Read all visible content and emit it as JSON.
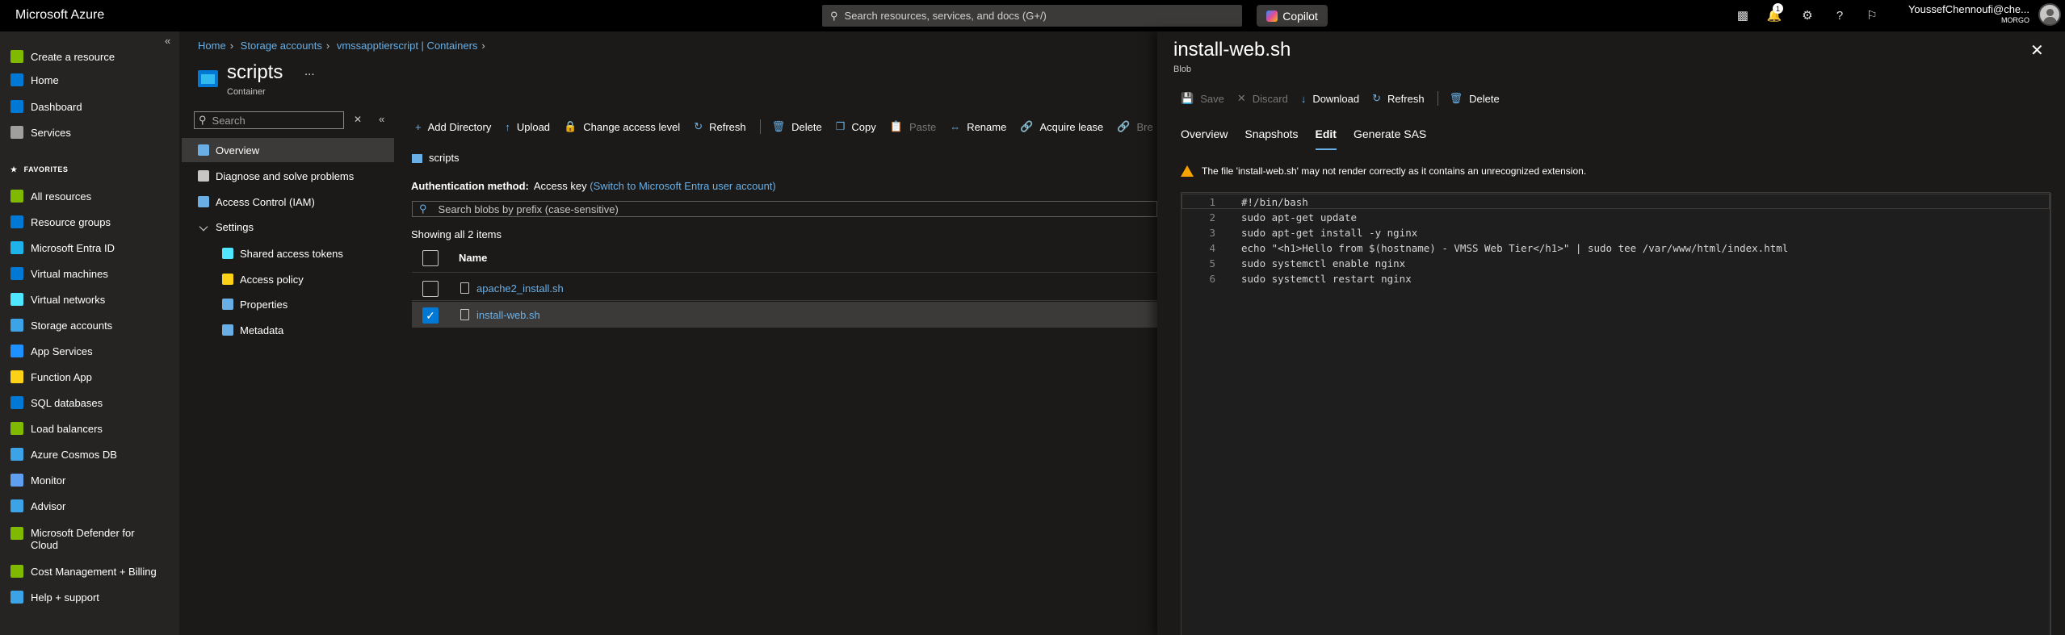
{
  "topbar": {
    "brand": "Microsoft Azure",
    "search_placeholder": "Search resources, services, and docs (G+/)",
    "copilot_label": "Copilot",
    "notification_count": "1",
    "user_name": "YoussefChennoufi@che...",
    "user_org": "MORGO"
  },
  "leftnav": {
    "items": [
      {
        "label": "Create a resource",
        "icon": "plus-icon",
        "color": "#7fba00"
      },
      {
        "label": "Home",
        "icon": "home-icon",
        "color": "#0078d4"
      },
      {
        "label": "Dashboard",
        "icon": "dashboard-icon",
        "color": "#0078d4"
      },
      {
        "label": "Services",
        "icon": "list-icon",
        "color": "#a19f9d"
      }
    ],
    "favorites_label": "FAVORITES",
    "favorites": [
      {
        "label": "All resources",
        "icon": "grid-icon",
        "color": "#7fba00"
      },
      {
        "label": "Resource groups",
        "icon": "resource-group-icon",
        "color": "#0078d4"
      },
      {
        "label": "Microsoft Entra ID",
        "icon": "entra-icon",
        "color": "#1fb3ec"
      },
      {
        "label": "Virtual machines",
        "icon": "vm-icon",
        "color": "#0078d4"
      },
      {
        "label": "Virtual networks",
        "icon": "vnet-icon",
        "color": "#50e6ff"
      },
      {
        "label": "Storage accounts",
        "icon": "storage-icon",
        "color": "#3ba3e6"
      },
      {
        "label": "App Services",
        "icon": "app-service-icon",
        "color": "#1e90ff"
      },
      {
        "label": "Function App",
        "icon": "function-icon",
        "color": "#fcd116"
      },
      {
        "label": "SQL databases",
        "icon": "sql-icon",
        "color": "#0078d4"
      },
      {
        "label": "Load balancers",
        "icon": "load-balancer-icon",
        "color": "#7fba00"
      },
      {
        "label": "Azure Cosmos DB",
        "icon": "cosmos-icon",
        "color": "#3ba3e6"
      },
      {
        "label": "Monitor",
        "icon": "monitor-icon",
        "color": "#5ea0ef"
      },
      {
        "label": "Advisor",
        "icon": "advisor-icon",
        "color": "#3ba3e6"
      },
      {
        "label": "Microsoft Defender for Cloud",
        "icon": "defender-icon",
        "color": "#7fba00"
      },
      {
        "label": "Cost Management + Billing",
        "icon": "cost-icon",
        "color": "#7fba00"
      },
      {
        "label": "Help + support",
        "icon": "help-support-icon",
        "color": "#3ba3e6"
      }
    ]
  },
  "breadcrumb": [
    "Home",
    "Storage accounts",
    "vmssapptierscript | Containers"
  ],
  "page": {
    "title": "scripts",
    "subtitle": "Container",
    "more": "..."
  },
  "resource_menu": {
    "search_placeholder": "Search",
    "items": [
      {
        "label": "Overview",
        "icon": "overview-icon"
      },
      {
        "label": "Diagnose and solve problems",
        "icon": "wrench-icon"
      },
      {
        "label": "Access Control (IAM)",
        "icon": "iam-icon"
      },
      {
        "label": "Settings",
        "icon": "chevron-down-icon"
      },
      {
        "label": "Shared access tokens",
        "icon": "link-icon"
      },
      {
        "label": "Access policy",
        "icon": "key-icon"
      },
      {
        "label": "Properties",
        "icon": "properties-icon"
      },
      {
        "label": "Metadata",
        "icon": "info-icon"
      }
    ]
  },
  "toolbar": {
    "add_directory": "Add Directory",
    "upload": "Upload",
    "change_access_level": "Change access level",
    "refresh": "Refresh",
    "delete": "Delete",
    "copy": "Copy",
    "paste": "Paste",
    "rename": "Rename",
    "acquire_lease": "Acquire lease",
    "break_lease": "Bre"
  },
  "container": {
    "path": "scripts",
    "auth_label": "Authentication method:",
    "auth_value": "Access key",
    "auth_link": "(Switch to Microsoft Entra user account)",
    "blob_search_placeholder": "Search blobs by prefix (case-sensitive)",
    "showing": "Showing all 2 items",
    "column_name": "Name",
    "rows": [
      {
        "name": "apache2_install.sh",
        "selected": false
      },
      {
        "name": "install-web.sh",
        "selected": true
      }
    ]
  },
  "panel": {
    "title": "install-web.sh",
    "subtitle": "Blob",
    "toolbar": {
      "save": "Save",
      "discard": "Discard",
      "download": "Download",
      "refresh": "Refresh",
      "delete": "Delete"
    },
    "tabs": [
      "Overview",
      "Snapshots",
      "Edit",
      "Generate SAS"
    ],
    "active_tab": "Edit",
    "warning": "The file 'install-web.sh' may not render correctly as it contains an unrecognized extension.",
    "code_lines": [
      {
        "n": "1",
        "text": "#!/bin/bash"
      },
      {
        "n": "2",
        "text": "sudo apt-get update"
      },
      {
        "n": "3",
        "text": "sudo apt-get install -y nginx"
      },
      {
        "n": "4",
        "text": "echo \"<h1>Hello from $(hostname) - VMSS Web Tier</h1>\" | sudo tee /var/www/html/index.html"
      },
      {
        "n": "5",
        "text": "sudo systemctl enable nginx"
      },
      {
        "n": "6",
        "text": "sudo systemctl restart nginx"
      }
    ]
  }
}
